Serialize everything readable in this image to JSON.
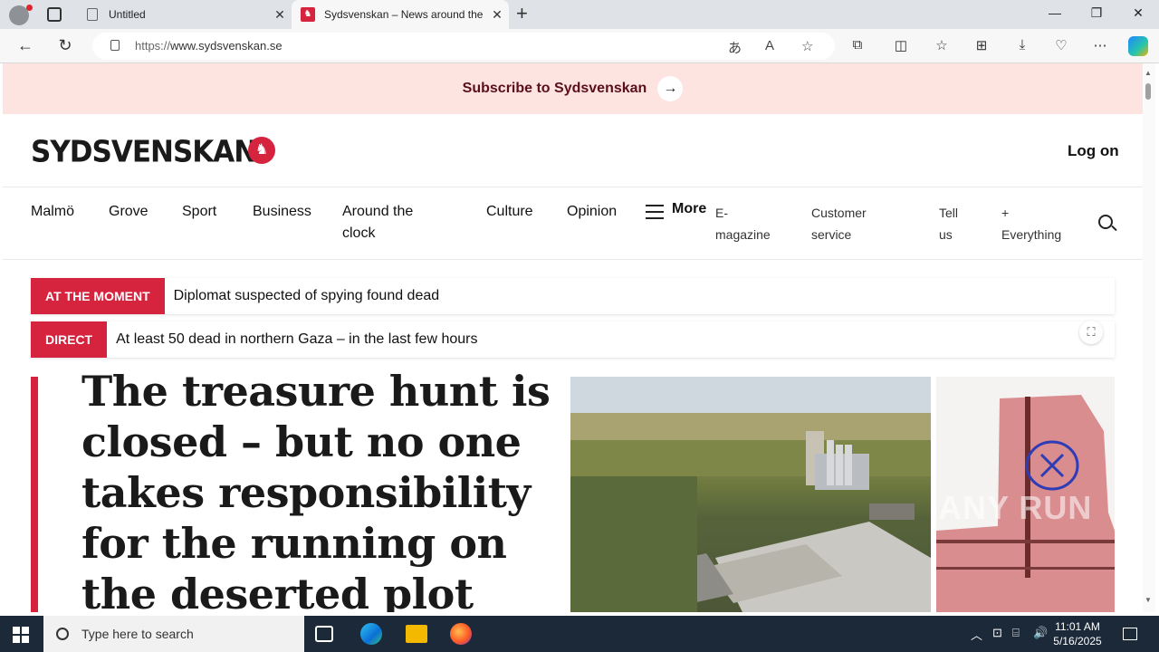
{
  "browser": {
    "tabs": [
      {
        "title": "Untitled"
      },
      {
        "title": "Sydsvenskan – News around the"
      }
    ],
    "url_prefix": "https://",
    "url_domain": "www.sydsvenskan.se"
  },
  "page": {
    "subscribe_text": "Subscribe to Sydsvenskan",
    "logo": "SYDSVENSKAN",
    "login": "Log on",
    "nav": {
      "malmo": "Malmö",
      "grove": "Grove",
      "sport": "Sport",
      "business": "Business",
      "around1": "Around the",
      "around2": "clock",
      "culture": "Culture",
      "opinion": "Opinion",
      "more": "More",
      "emag1": "E-",
      "emag2": "magazine",
      "cust1": "Customer",
      "cust2": "service",
      "tell1": "Tell",
      "tell2": "us",
      "every1": "+",
      "every2": "Everything"
    },
    "tickers": [
      {
        "label": "AT THE MOMENT",
        "text": "Diplomat suspected of spying found dead"
      },
      {
        "label": "DIRECT",
        "text": "At least 50 dead in northern Gaza – in the last few hours"
      }
    ],
    "headline": "The treasure hunt is closed – but no one takes responsibility for the running on the deserted plot",
    "watermark": "ANY RUN"
  },
  "taskbar": {
    "search_placeholder": "Type here to search",
    "time": "11:01 AM",
    "date": "5/16/2025"
  }
}
